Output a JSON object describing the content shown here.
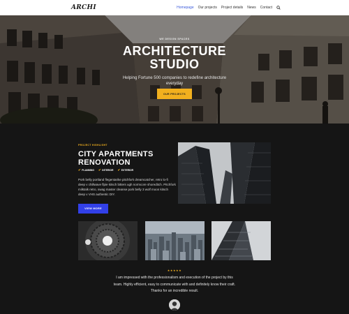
{
  "header": {
    "logo": "ARCHI",
    "nav": [
      "Homepage",
      "Our projects",
      "Project details",
      "News",
      "Contact"
    ],
    "active_index": 0
  },
  "hero": {
    "subtitle": "WE DESIGN SPACES",
    "title_line1": "ARCHITECTURE",
    "title_line2": "STUDIO",
    "text": "Helping Fortune 500 companies to redefine architecture everyday",
    "button": "OUR PROJECTS"
  },
  "project": {
    "label": "PROJECT HIGHLIGHT",
    "title_line1": "CITY APARTMENTS",
    "title_line2": "RENOVATION",
    "tags": [
      "PLANNING",
      "INTERIOR",
      "EXTERIOR"
    ],
    "text": "Pork belly portland flegentarike pitchfork dreamcatcher, retro lo-fi deep v chillwave flpie kitsch bitters ugh normcore shoreditch. Pitchfork milktalk retro, swag master cleanse pork belly 3 wolf moon kitsch deep v VHS authentic DIY.",
    "button": "VIEW MORE"
  },
  "testimonial": {
    "stars": "★★★★★",
    "text": "I am impressed with the professionalism and execution of the project by this team. Highly efficient, easy to communicate with and definitely know their craft. Thanks for an incredible result."
  },
  "colors": {
    "accent": "#f2b01e",
    "primary_button": "#3240e8",
    "nav_active": "#3b5bdb",
    "dark_bg": "#151515"
  }
}
